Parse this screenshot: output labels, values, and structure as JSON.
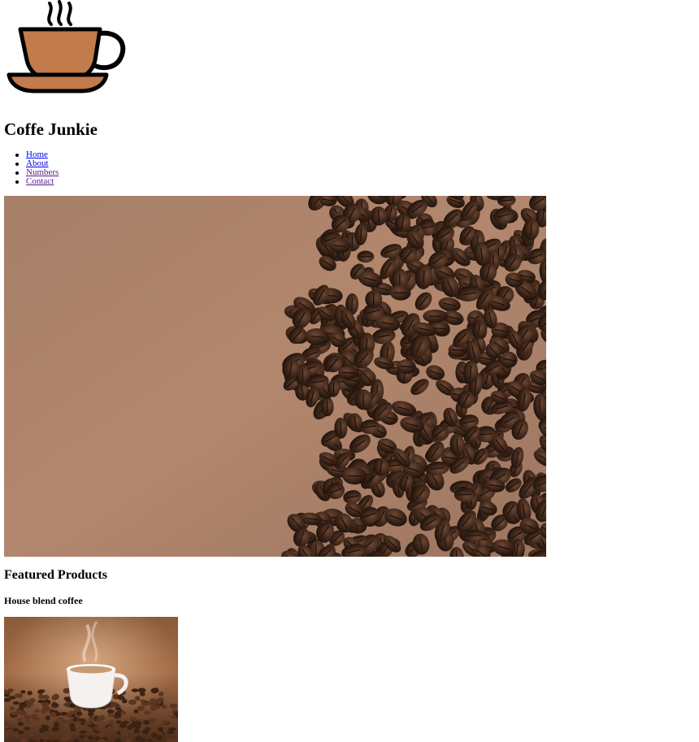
{
  "header": {
    "logo_icon": "coffee-cup-icon",
    "site_title": "Coffe Junkie"
  },
  "nav": {
    "items": [
      {
        "label": "Home",
        "visited": false
      },
      {
        "label": "About",
        "visited": false
      },
      {
        "label": "Numbers",
        "visited": true
      },
      {
        "label": "Contact",
        "visited": true
      }
    ],
    "link_color": "#0000ee",
    "visited_color": "#551a8b"
  },
  "hero": {
    "image": "coffee-beans-on-brown-background"
  },
  "featured": {
    "title": "Featured Products",
    "products": [
      {
        "name": "House blend coffee",
        "image": "steaming-cup-on-coffee-beans"
      }
    ]
  },
  "colors": {
    "cup_fill": "#c27b4a",
    "background_tan": "#a77f68",
    "bean_dark": "#3a2418"
  }
}
